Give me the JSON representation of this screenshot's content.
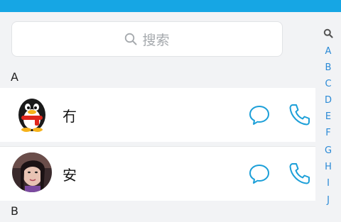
{
  "search": {
    "placeholder": "搜索"
  },
  "sections": [
    {
      "letter": "A",
      "contacts": [
        {
          "name": "冇",
          "avatar": "qq-penguin-avatar"
        },
        {
          "name": "安",
          "avatar": "photo-avatar"
        }
      ]
    },
    {
      "letter": "B",
      "contacts": []
    }
  ],
  "index_bar": {
    "search_icon": "search-icon",
    "letters": [
      "A",
      "B",
      "C",
      "D",
      "E",
      "F",
      "G",
      "H",
      "I",
      "J"
    ]
  },
  "colors": {
    "accent": "#16a6e4",
    "icon": "#1c9fd8",
    "index_text": "#2b8ad6",
    "background": "#f2f3f5"
  }
}
